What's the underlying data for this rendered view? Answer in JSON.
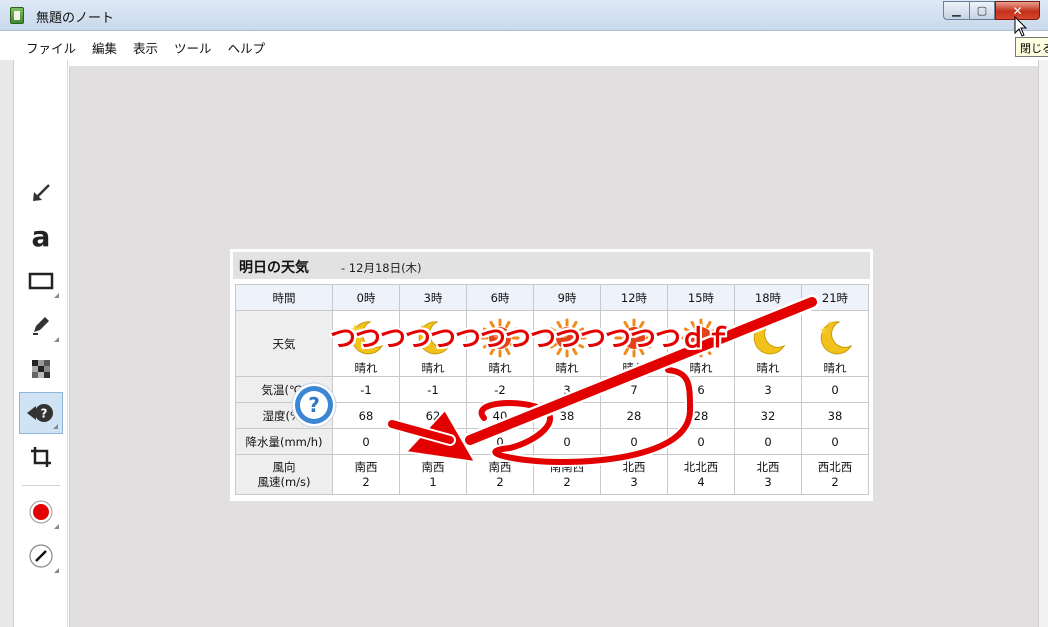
{
  "window": {
    "title": "無題のノート",
    "controls": {
      "minimize": "▁",
      "maximize": "▢",
      "close": "✕"
    },
    "close_tooltip": "閉じる"
  },
  "menu": [
    "ファイル",
    "編集",
    "表示",
    "ツール",
    "ヘルプ"
  ],
  "toolbar": {
    "tools": [
      "arrow-tool",
      "text-tool",
      "rectangle-tool",
      "pen-tool",
      "mosaic-tool",
      "help-stamp-tool",
      "crop-tool"
    ],
    "text_tool_glyph": "a",
    "active_tool": "help-stamp-tool",
    "color": "#e30000",
    "line_width_icon": "line-width-icon"
  },
  "weather": {
    "title": "明日の天気",
    "date": " - 12月18日(木)",
    "row_labels": {
      "time": "時間",
      "weather": "天気",
      "temp": "気温(℃)",
      "humidity": "湿度(%)",
      "precip": "降水量(mm/h)",
      "wind_line1": "風向",
      "wind_line2": "風速(m/s)"
    },
    "columns": [
      {
        "time": "0時",
        "icon": "moon-sun",
        "cond": "晴れ",
        "temp": "-1",
        "humidity": "68",
        "precip": "0",
        "wind_dir": "南西",
        "wind_speed": "2"
      },
      {
        "time": "3時",
        "icon": "moon-sun",
        "cond": "晴れ",
        "temp": "-1",
        "humidity": "62",
        "precip": "0",
        "wind_dir": "南西",
        "wind_speed": "1"
      },
      {
        "time": "6時",
        "icon": "sun",
        "cond": "晴れ",
        "temp": "-2",
        "humidity": "40",
        "precip": "0",
        "wind_dir": "南西",
        "wind_speed": "2"
      },
      {
        "time": "9時",
        "icon": "sun",
        "cond": "晴れ",
        "temp": "3",
        "humidity": "38",
        "precip": "0",
        "wind_dir": "南南西",
        "wind_speed": "2"
      },
      {
        "time": "12時",
        "icon": "sun",
        "cond": "晴れ",
        "temp": "7",
        "humidity": "28",
        "precip": "0",
        "wind_dir": "北西",
        "wind_speed": "3"
      },
      {
        "time": "15時",
        "icon": "sun",
        "cond": "晴れ",
        "temp": "6",
        "humidity": "28",
        "precip": "0",
        "wind_dir": "北北西",
        "wind_speed": "4"
      },
      {
        "time": "18時",
        "icon": "moon",
        "cond": "晴れ",
        "temp": "3",
        "humidity": "32",
        "precip": "0",
        "wind_dir": "北西",
        "wind_speed": "3"
      },
      {
        "time": "21時",
        "icon": "moon",
        "cond": "晴れ",
        "temp": "0",
        "humidity": "38",
        "precip": "0",
        "wind_dir": "西北西",
        "wind_speed": "2"
      }
    ]
  },
  "annotations": {
    "text": "つつつつつつつつつつつつつつｄｆ",
    "stamp": "?",
    "color": "#e30000"
  }
}
